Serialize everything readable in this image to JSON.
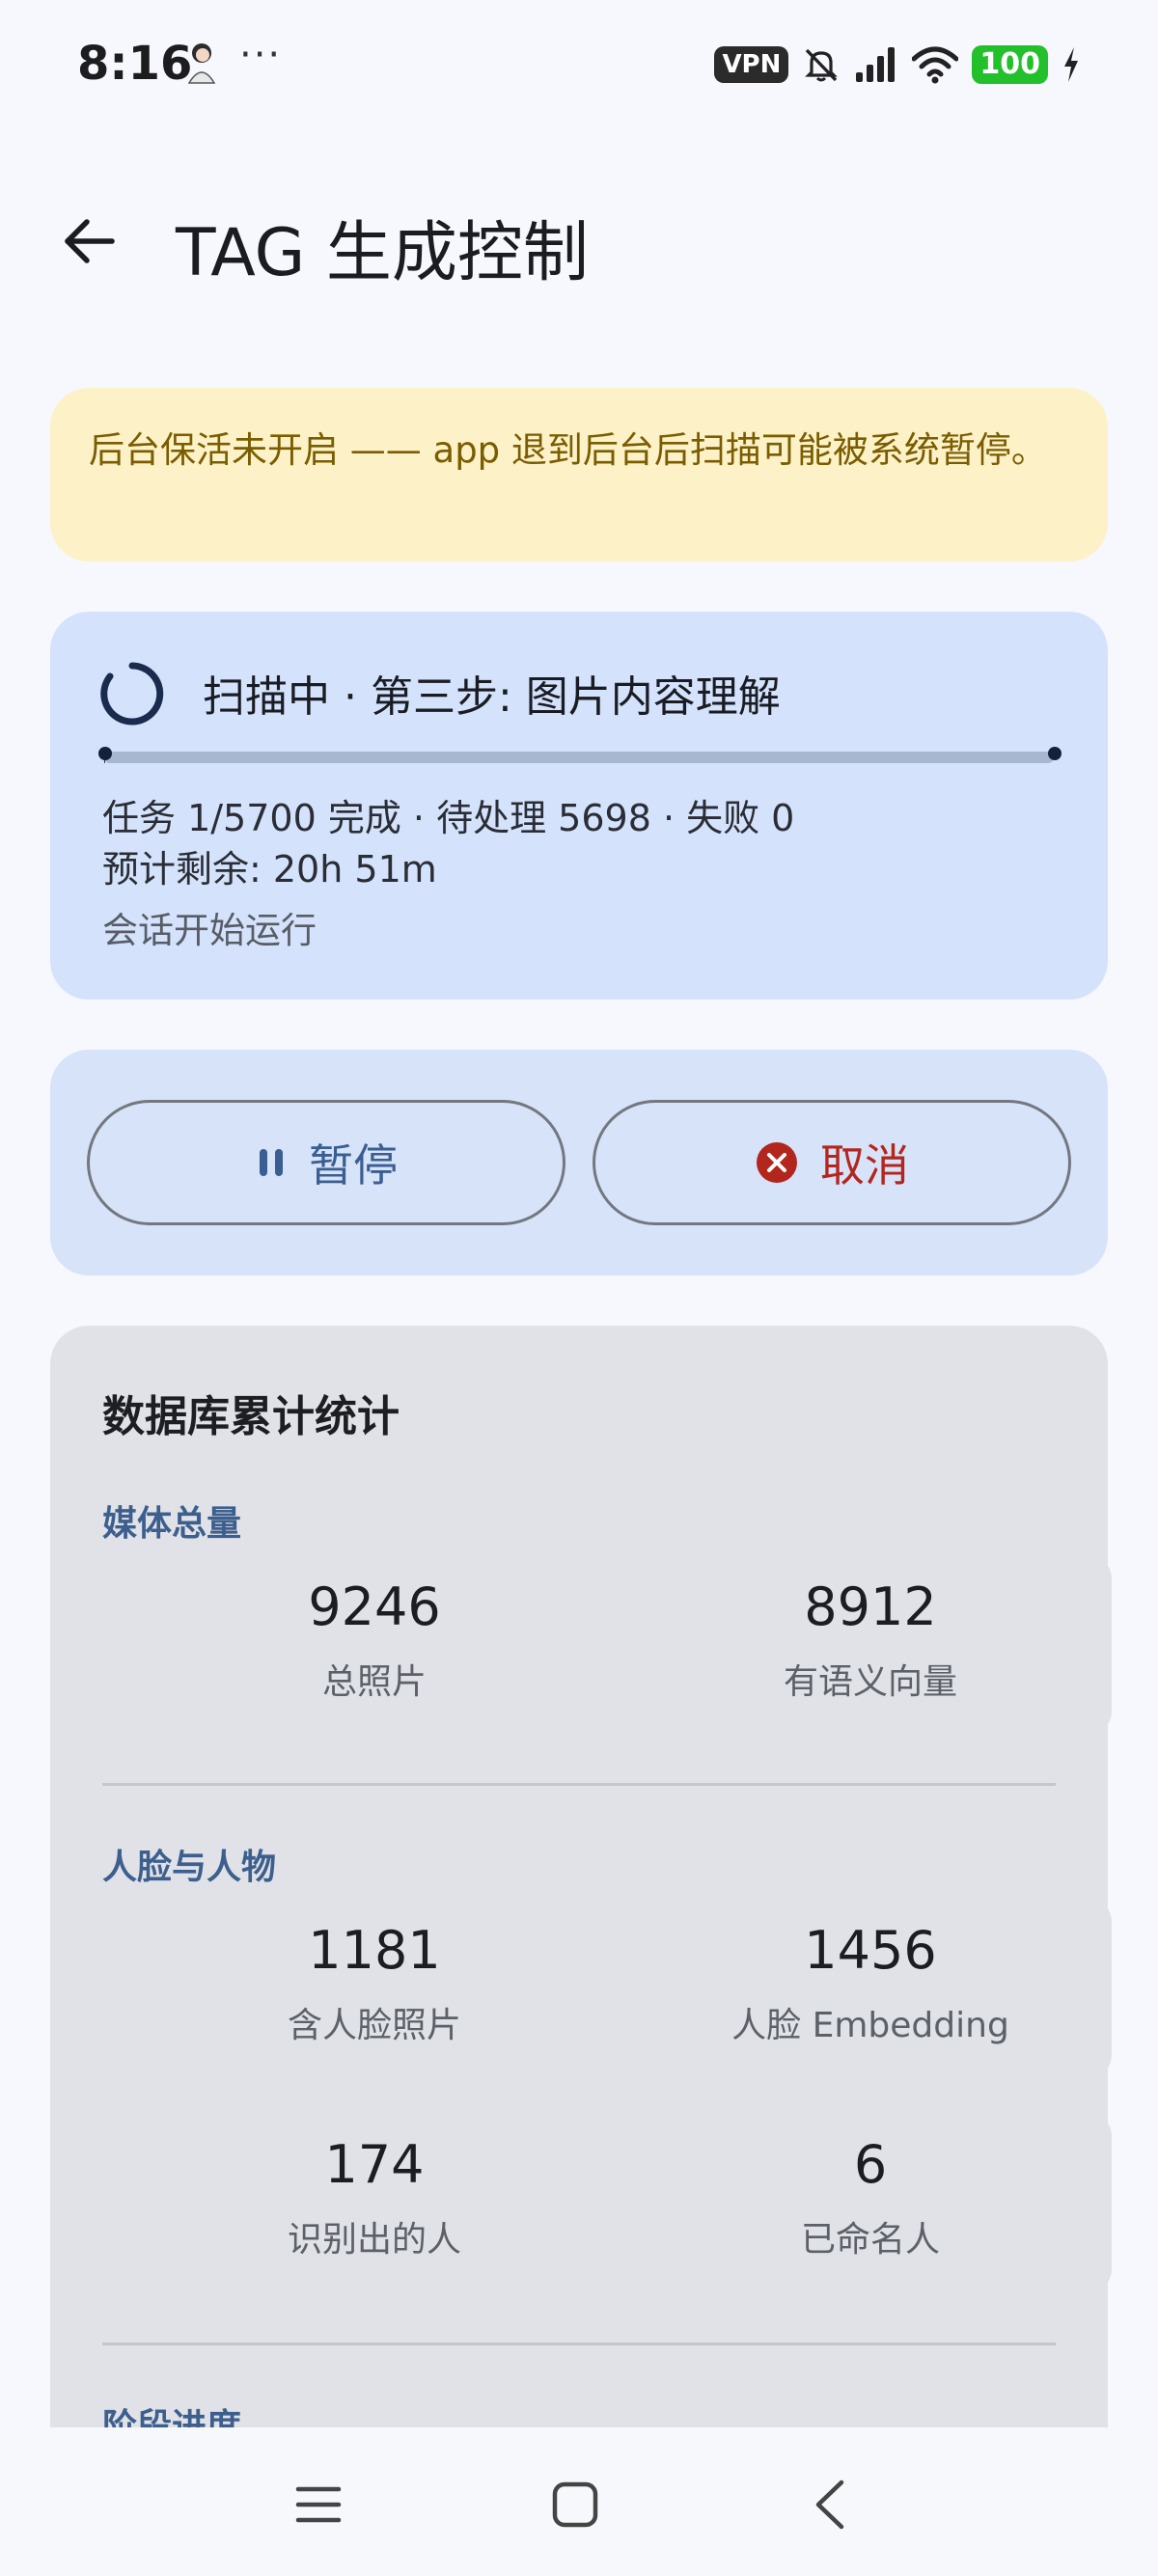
{
  "status_bar": {
    "time": "8:16",
    "more": "···",
    "vpn": "VPN",
    "battery": "100"
  },
  "app_bar": {
    "title": "TAG 生成控制"
  },
  "warning": {
    "text": "后台保活未开启 —— app 退到后台后扫描可能被系统暂停。"
  },
  "scan": {
    "title": "扫描中 · 第三步: 图片内容理解",
    "progress": 0.0002,
    "tasks_line": "任务 1/5700 完成 · 待处理 5698 · 失败 0",
    "eta": "预计剩余: 20h 51m",
    "session_status": "会话开始运行"
  },
  "actions": {
    "pause_label": "暂停",
    "cancel_label": "取消"
  },
  "stats": {
    "title": "数据库累计统计",
    "sections": [
      {
        "label": "媒体总量",
        "items": [
          {
            "value": "9246",
            "label": "总照片"
          },
          {
            "value": "8912",
            "label": "有语义向量"
          }
        ]
      },
      {
        "label": "人脸与人物",
        "items": [
          {
            "value": "1181",
            "label": "含人脸照片"
          },
          {
            "value": "1456",
            "label": "人脸 Embedding"
          },
          {
            "value": "174",
            "label": "识别出的人"
          },
          {
            "value": "6",
            "label": "已命名人"
          }
        ]
      },
      {
        "label": "阶段进度"
      }
    ]
  },
  "colors": {
    "warning_bg": "#fdf1c8",
    "scan_bg": "#d4e3fb",
    "pause_accent": "#3a5e92",
    "cancel_accent": "#b3261e",
    "section_label": "#3d5f8e"
  },
  "icons": {
    "back": "arrow-left-icon",
    "spinner": "progress-spinner-icon",
    "pause": "pause-icon",
    "cancel": "cancel-circle-icon",
    "nav_menu": "menu-icon",
    "nav_home": "home-icon",
    "nav_back": "chevron-left-icon"
  }
}
